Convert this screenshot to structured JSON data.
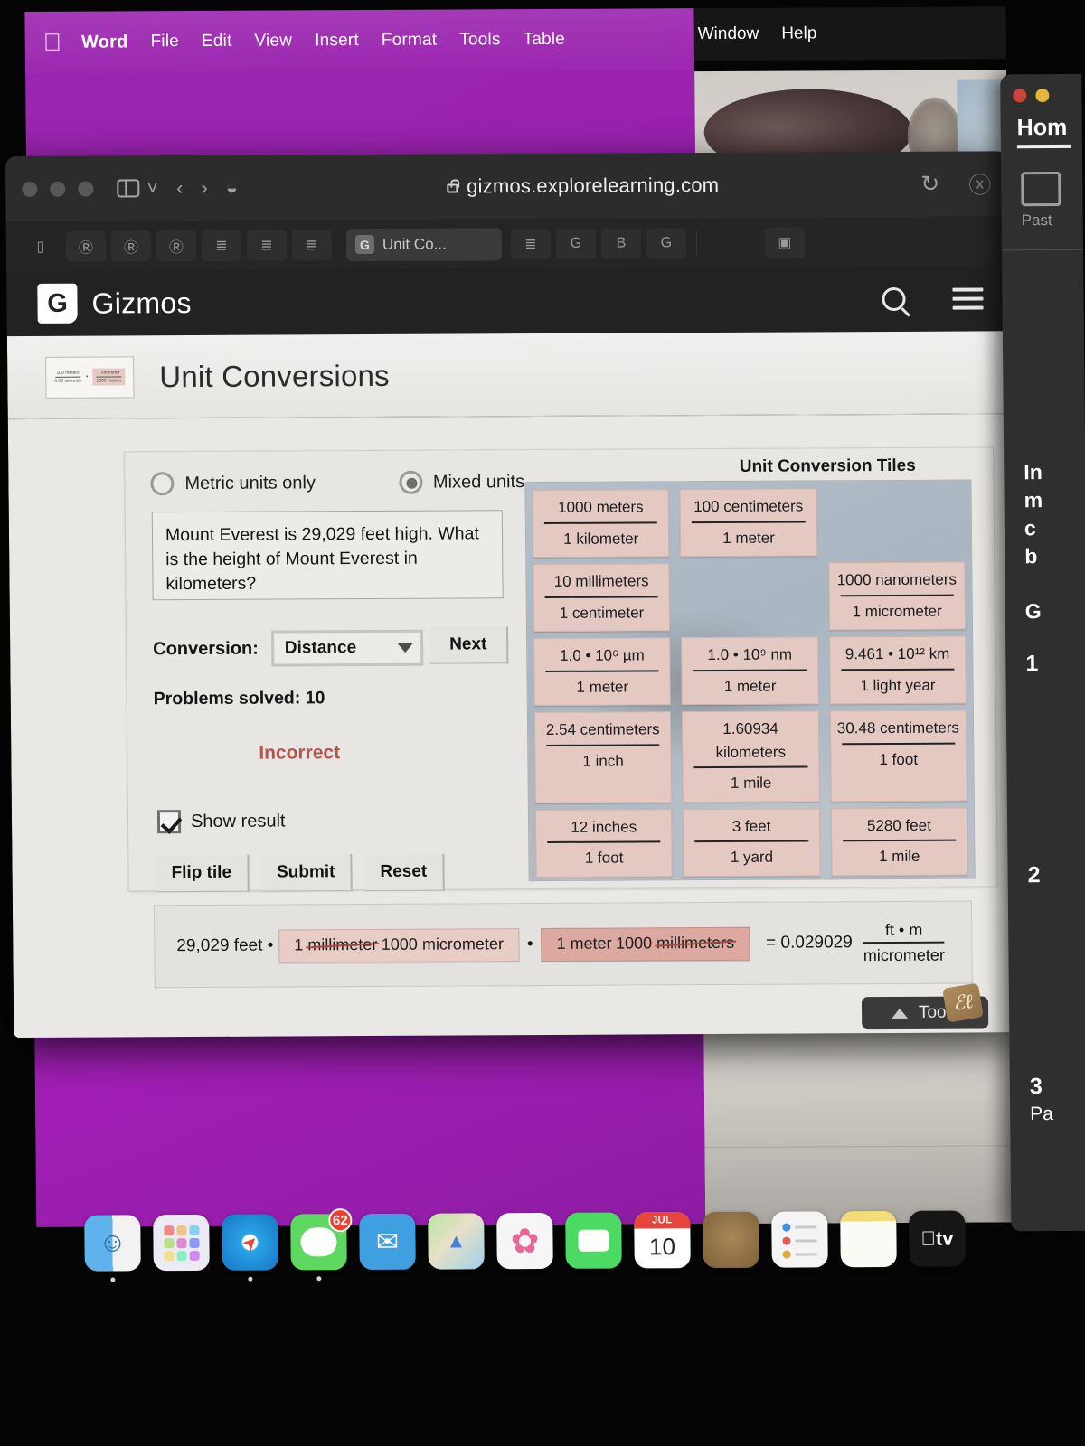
{
  "menubar": {
    "apple_icon": "apple-icon",
    "items": [
      "Word",
      "File",
      "Edit",
      "View",
      "Insert",
      "Format",
      "Tools",
      "Table",
      "Window",
      "Help"
    ]
  },
  "browser": {
    "url": "gizmos.explorelearning.com",
    "lock_icon": "lock-icon",
    "reload_icon": "reload-icon",
    "downloads_icon": "download-icon",
    "sidebar_icon": "sidebar-icon",
    "back_icon": "chevron-left-icon",
    "forward_icon": "chevron-right-icon",
    "shield_icon": "shield-icon",
    "active_tab": "Unit Co...",
    "tab_favicon": "G",
    "tab_icons": [
      "reader-icon",
      "R",
      "R",
      "R",
      "list-icon",
      "list-icon",
      "list-icon"
    ],
    "tab_icons_right": [
      "list-icon",
      "G",
      "B",
      "G",
      "m"
    ]
  },
  "gizmo_header": {
    "logo_letter": "G",
    "brand": "Gizmos",
    "search_icon": "search-icon",
    "menu_icon": "hamburger-menu-icon"
  },
  "gizmo_title": {
    "thumbnail_icon": "unit-conversion-thumbnail-icon",
    "title": "Unit Conversions"
  },
  "controls": {
    "radio_metric_label": "Metric units only",
    "radio_mixed_label": "Mixed units",
    "radio_selected": "mixed",
    "question": "Mount Everest is 29,029 feet high. What is the height of Mount Everest in kilometers?",
    "conversion_label": "Conversion:",
    "conversion_value": "Distance",
    "next_label": "Next",
    "problems_solved": "Problems solved: 10",
    "verdict": "Incorrect",
    "verdict_color": "#b5534e",
    "show_result_label": "Show result",
    "show_result_checked": true,
    "buttons": [
      "Flip tile",
      "Submit",
      "Reset"
    ]
  },
  "tiles": {
    "heading": "Unit Conversion Tiles",
    "items": [
      {
        "num": "1000 meters",
        "den": "1 kilometer"
      },
      {
        "num": "100 centimeters",
        "den": "1 meter"
      },
      {
        "empty": true
      },
      {
        "num": "10 millimeters",
        "den": "1 centimeter"
      },
      {
        "empty": true
      },
      {
        "num": "1000 nanometers",
        "den": "1 micrometer"
      },
      {
        "num": "1.0 • 10⁶ µm",
        "den": "1 meter"
      },
      {
        "num": "1.0 • 10⁹ nm",
        "den": "1 meter"
      },
      {
        "num": "9.461 • 10¹² km",
        "den": "1 light year"
      },
      {
        "num": "2.54 centimeters",
        "den": "1 inch"
      },
      {
        "num": "1.60934 kilometers",
        "den": "1 mile"
      },
      {
        "num": "30.48 centimeters",
        "den": "1 foot"
      },
      {
        "num": "12 inches",
        "den": "1 foot"
      },
      {
        "num": "3 feet",
        "den": "1 yard"
      },
      {
        "num": "5280 feet",
        "den": "1 mile"
      }
    ],
    "tile_color": "#e4c9c3",
    "board_color": "#b0bcc7"
  },
  "equation": {
    "lead": "29,029 feet •",
    "tile1_num": "1 millimeter",
    "tile1_den": "1000 micrometer",
    "dot": "•",
    "tile2_num": "1 meter",
    "tile2_den": "1000 millimeters",
    "result": "= 0.029029",
    "result_frac_top": "ft • m",
    "result_frac_bottom": "micrometer",
    "tile2_selected": true
  },
  "tools_button": {
    "label": "Tools",
    "arrow_icon": "triangle-up-icon",
    "badge_icon": "signature-badge-icon",
    "badge_glyph": "ℰℓ"
  },
  "word_window": {
    "tab": "Hom",
    "paste_label": "Past",
    "paste_icon": "paste-icon",
    "doc_lines": [
      "In",
      "m",
      "c",
      "b"
    ],
    "doc_g": "G",
    "num1": "1",
    "num2": "2",
    "num3": "3",
    "pa": "Pa"
  },
  "dock": {
    "items": [
      {
        "name": "finder",
        "glyph": "",
        "color": "#4da6e8"
      },
      {
        "name": "launchpad",
        "glyph": "",
        "color": "#e8e6ef"
      },
      {
        "name": "safari",
        "glyph": "",
        "color": "#1e9fe8"
      },
      {
        "name": "messages",
        "glyph": "",
        "color": "#5ed860",
        "badge": "62"
      },
      {
        "name": "mail",
        "glyph": "✉",
        "color": "#3f9fe0"
      },
      {
        "name": "maps",
        "glyph": "",
        "color": "#9fd88a"
      },
      {
        "name": "photos",
        "glyph": "",
        "color": "#f6f6f6"
      },
      {
        "name": "facetime",
        "glyph": "",
        "color": "#4cd964"
      },
      {
        "name": "calendar",
        "glyph": "",
        "color": "#ffffff",
        "month": "JUL",
        "day": "10"
      },
      {
        "name": "podcasts",
        "glyph": "",
        "color": "#8a6b48"
      },
      {
        "name": "reminders",
        "glyph": "",
        "color": "#f4f4f4"
      },
      {
        "name": "notes",
        "glyph": "",
        "color": "#f6e7a8"
      },
      {
        "name": "apple-tv",
        "glyph": "tv",
        "color": "#161616"
      }
    ]
  }
}
